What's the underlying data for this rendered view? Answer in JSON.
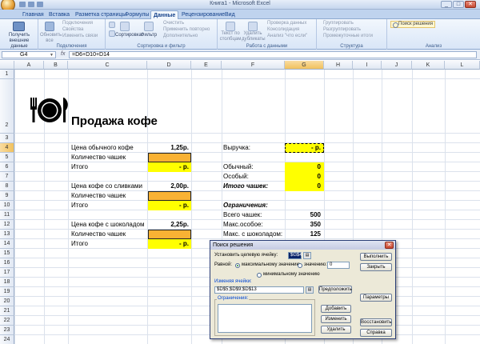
{
  "window": {
    "title": "Книга1 - Microsoft Excel",
    "controls": [
      "_",
      "□",
      "✕"
    ]
  },
  "ribbon": {
    "tabs": [
      "Главная",
      "Вставка",
      "Разметка страницы",
      "Формулы",
      "Данные",
      "Рецензирование",
      "Вид"
    ],
    "active_tab": "Данные",
    "groups": {
      "external_data": {
        "button": "Получить внешние данные",
        "label": ""
      },
      "connections": {
        "label": "Подключения",
        "refresh": "Обновить все",
        "items": [
          "Подключения",
          "Свойства",
          "Изменить связи"
        ]
      },
      "sort_filter": {
        "label": "Сортировка и фильтр",
        "sort": "Сортировка",
        "filter": "Фильтр",
        "items": [
          "Очистить",
          "Применить повторно",
          "Дополнительно"
        ]
      },
      "data_tools": {
        "label": "Работа с данными",
        "text_to_columns": "Текст по столбцам",
        "remove_duplicates": "Удалить дубликаты",
        "items": [
          "Проверка данных",
          "Консолидация",
          "Анализ \"что если\""
        ]
      },
      "outline": {
        "label": "Структура",
        "items": [
          "Группировать",
          "Разгруппировать",
          "Промежуточные итоги"
        ]
      },
      "analysis": {
        "label": "Анализ",
        "solver": "Поиск решения"
      }
    }
  },
  "formula_bar": {
    "name_box": "G4",
    "fx": "fx",
    "formula": "=D6+D10+D14"
  },
  "grid": {
    "columns": [
      "A",
      "B",
      "C",
      "D",
      "E",
      "F",
      "G",
      "H",
      "I",
      "J",
      "K",
      "L"
    ],
    "selected_column": "G",
    "rows": [
      "1",
      "2",
      "3",
      "4",
      "5",
      "6",
      "7",
      "8",
      "9",
      "10",
      "11",
      "12",
      "13",
      "14",
      "15",
      "16",
      "17",
      "18",
      "19",
      "20",
      "21",
      "22",
      "23",
      "24"
    ],
    "selected_row": "4"
  },
  "sheet": {
    "title": "Продажа кофе",
    "icon": "plate-fork-knife-icon",
    "left_block": [
      {
        "label": "Цена обычного кофе",
        "price": "1,25р."
      },
      {
        "label": "Количество чашек"
      },
      {
        "label": "Итого",
        "total": "-    р."
      },
      {
        "label": "Цена кофе со сливками",
        "price": "2,00р."
      },
      {
        "label": "Количество чашек"
      },
      {
        "label": "Итого",
        "total": "-    р."
      },
      {
        "label": "Цена кофе с шоколадом",
        "price": "2,25р."
      },
      {
        "label": "Количество чашек"
      },
      {
        "label": "Итого",
        "total": "-    р."
      }
    ],
    "revenue": {
      "label": "Выручка:",
      "value": "-    р."
    },
    "counts": [
      {
        "label": "Обычный:",
        "value": "0"
      },
      {
        "label": "Особый:",
        "value": "0"
      },
      {
        "label": "Итого чашек:",
        "value": "0"
      }
    ],
    "constraints_title": "Ограничения:",
    "constraints": [
      {
        "label": "Всего чашек:",
        "value": "500"
      },
      {
        "label": "Макс.особое:",
        "value": "350"
      },
      {
        "label": "Макс. с шоколадом:",
        "value": "125"
      }
    ]
  },
  "solver": {
    "title": "Поиск решения",
    "target_label": "Установить целевую ячейку:",
    "target_value": "$G$4",
    "equal_label": "Равной:",
    "opt_max": "максимальному значению",
    "opt_value": "значению:",
    "opt_value_field": "0",
    "opt_min": "минимальному значению",
    "changing_label": "Изменяя ячейки:",
    "changing_value": "$D$5;$D$9;$D$13",
    "guess": "Предположить",
    "constraints_label": "Ограничения:",
    "buttons": {
      "run": "Выполнить",
      "close": "Закрыть",
      "params": "Параметры",
      "add": "Добавить",
      "change": "Изменить",
      "delete": "Удалить",
      "reset": "Восстановить",
      "help": "Справка"
    }
  }
}
